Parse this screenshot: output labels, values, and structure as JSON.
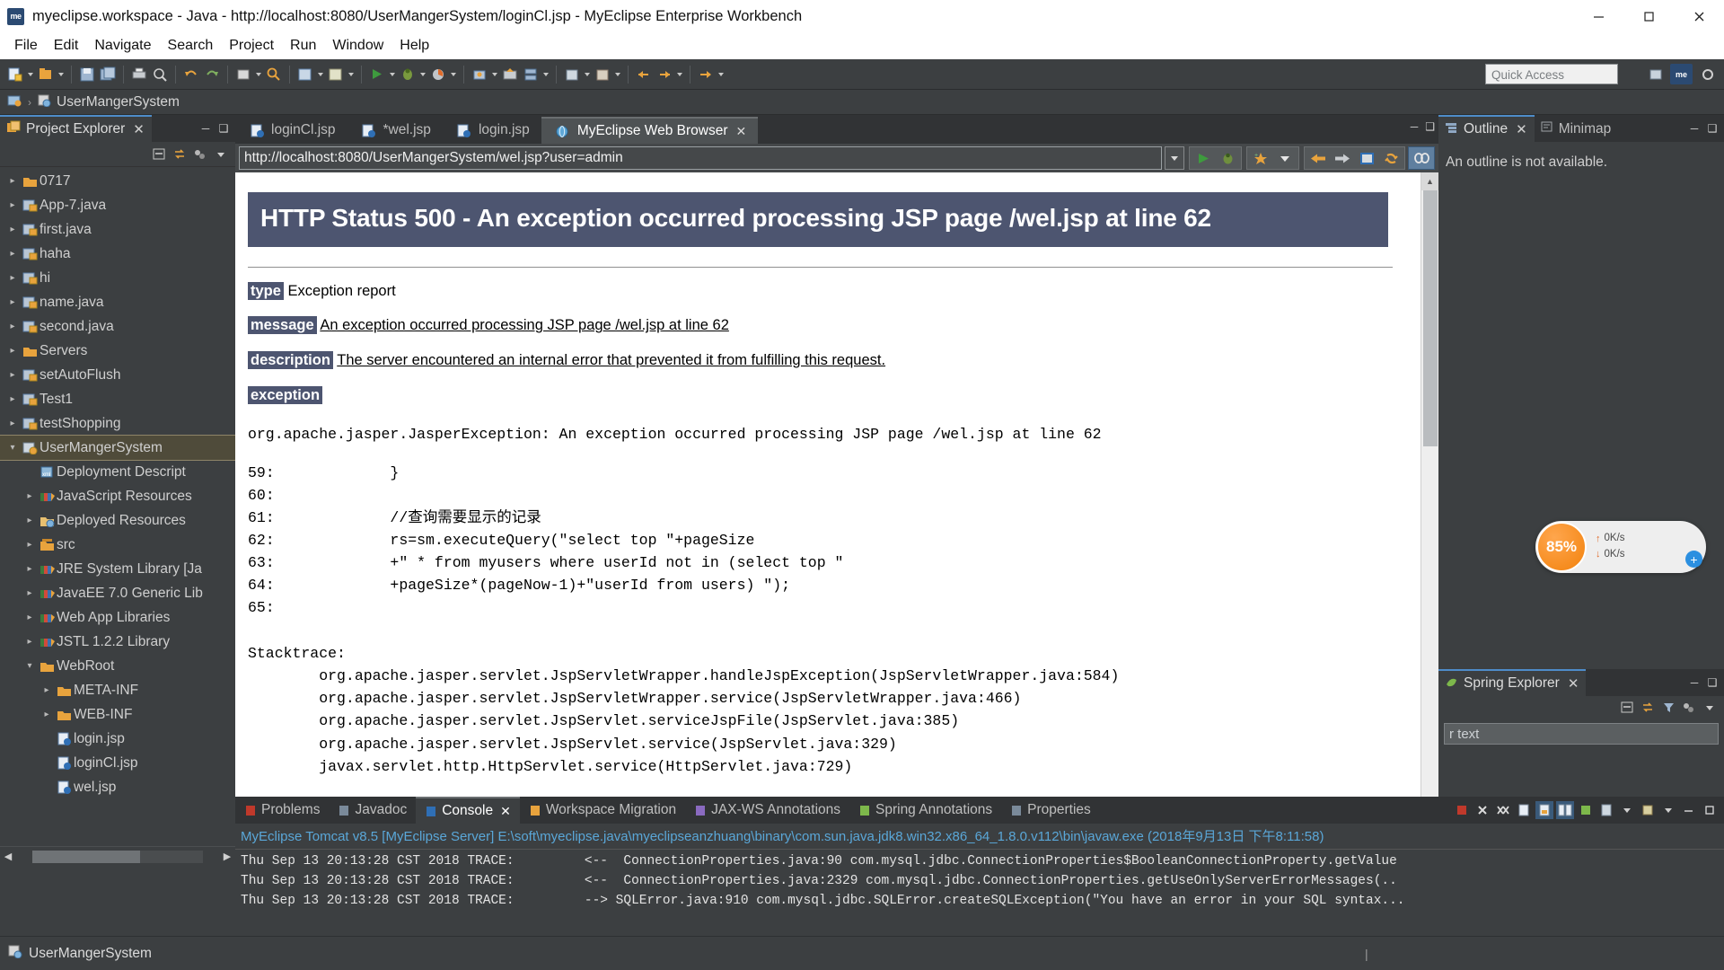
{
  "window": {
    "title": "myeclipse.workspace - Java - http://localhost:8080/UserMangerSystem/loginCl.jsp - MyEclipse Enterprise Workbench",
    "logo_text": "me",
    "minimize_label": "─",
    "maximize_label": "❐",
    "close_label": "✕"
  },
  "menubar": {
    "items": [
      {
        "label": "File"
      },
      {
        "label": "Edit"
      },
      {
        "label": "Navigate"
      },
      {
        "label": "Search"
      },
      {
        "label": "Project"
      },
      {
        "label": "Run"
      },
      {
        "label": "Window"
      },
      {
        "label": "Help"
      }
    ]
  },
  "toolbar": {
    "quick_access_placeholder": "Quick Access",
    "perspective_buttons": [
      "⌘",
      "me",
      "⚙"
    ]
  },
  "breadcrumb": {
    "root_icon": "java-perspective-icon",
    "separator": "›",
    "project": "UserMangerSystem"
  },
  "project_explorer": {
    "tab_label": "Project Explorer",
    "tab_close": "✕",
    "minimize": "─",
    "maximize": "❑",
    "toolbar_icons": [
      "collapse-all-icon",
      "link-with-editor-icon",
      "view-menu-icon",
      "view-dropdown-icon"
    ],
    "items": [
      {
        "label": "0717",
        "icon": "folder-icon",
        "arrow": "closed",
        "indent": 0,
        "selected": false
      },
      {
        "label": "App-7.java",
        "icon": "java-project-icon",
        "arrow": "closed",
        "indent": 0,
        "selected": false
      },
      {
        "label": "first.java",
        "icon": "java-project-icon",
        "arrow": "closed",
        "indent": 0,
        "selected": false
      },
      {
        "label": "haha",
        "icon": "java-project-icon",
        "arrow": "closed",
        "indent": 0,
        "selected": false
      },
      {
        "label": "hi",
        "icon": "java-project-icon",
        "arrow": "closed",
        "indent": 0,
        "selected": false
      },
      {
        "label": "name.java",
        "icon": "java-project-icon",
        "arrow": "closed",
        "indent": 0,
        "selected": false
      },
      {
        "label": "second.java",
        "icon": "java-project-icon",
        "arrow": "closed",
        "indent": 0,
        "selected": false
      },
      {
        "label": "Servers",
        "icon": "folder-icon",
        "arrow": "closed",
        "indent": 0,
        "selected": false
      },
      {
        "label": "setAutoFlush",
        "icon": "java-project-icon",
        "arrow": "closed",
        "indent": 0,
        "selected": false
      },
      {
        "label": "Test1",
        "icon": "java-project-icon",
        "arrow": "closed",
        "indent": 0,
        "selected": false
      },
      {
        "label": "testShopping",
        "icon": "java-project-icon",
        "arrow": "closed",
        "indent": 0,
        "selected": false
      },
      {
        "label": "UserMangerSystem",
        "icon": "web-project-icon",
        "arrow": "open",
        "indent": 0,
        "selected": true
      },
      {
        "label": "Deployment Descript",
        "icon": "deployment-descriptor-icon",
        "arrow": "none",
        "indent": 1,
        "selected": false
      },
      {
        "label": "JavaScript Resources",
        "icon": "library-icon",
        "arrow": "closed",
        "indent": 1,
        "selected": false
      },
      {
        "label": "Deployed Resources",
        "icon": "deployed-resources-icon",
        "arrow": "closed",
        "indent": 1,
        "selected": false
      },
      {
        "label": "src",
        "icon": "source-folder-icon",
        "arrow": "closed",
        "indent": 1,
        "selected": false
      },
      {
        "label": "JRE System Library  [Ja",
        "icon": "library-icon",
        "arrow": "closed",
        "indent": 1,
        "selected": false
      },
      {
        "label": "JavaEE 7.0 Generic Lib",
        "icon": "library-icon",
        "arrow": "closed",
        "indent": 1,
        "selected": false
      },
      {
        "label": "Web App Libraries",
        "icon": "library-icon",
        "arrow": "closed",
        "indent": 1,
        "selected": false
      },
      {
        "label": "JSTL 1.2.2 Library",
        "icon": "library-icon",
        "arrow": "closed",
        "indent": 1,
        "selected": false
      },
      {
        "label": "WebRoot",
        "icon": "folder-icon",
        "arrow": "open",
        "indent": 1,
        "selected": false
      },
      {
        "label": "META-INF",
        "icon": "folder-icon",
        "arrow": "closed",
        "indent": 2,
        "selected": false
      },
      {
        "label": "WEB-INF",
        "icon": "folder-icon",
        "arrow": "closed",
        "indent": 2,
        "selected": false
      },
      {
        "label": "login.jsp",
        "icon": "jsp-file-icon",
        "arrow": "none",
        "indent": 2,
        "selected": false
      },
      {
        "label": "loginCl.jsp",
        "icon": "jsp-file-icon",
        "arrow": "none",
        "indent": 2,
        "selected": false
      },
      {
        "label": "wel.jsp",
        "icon": "jsp-file-icon",
        "arrow": "none",
        "indent": 2,
        "selected": false
      }
    ]
  },
  "editor": {
    "tabs": [
      {
        "label": "loginCl.jsp",
        "icon": "jsp-file-icon",
        "active": false,
        "closable": false
      },
      {
        "label": "*wel.jsp",
        "icon": "jsp-file-icon",
        "active": false,
        "closable": false
      },
      {
        "label": "login.jsp",
        "icon": "jsp-file-icon",
        "active": false,
        "closable": false
      },
      {
        "label": "MyEclipse Web Browser",
        "icon": "globe-icon",
        "active": true,
        "closable": true
      }
    ],
    "tab_close": "✕",
    "minimize": "─",
    "maximize": "❑"
  },
  "browser": {
    "url": "http://localhost:8080/UserMangerSystem/wel.jsp?user=admin",
    "url_dropdown_icon": "chevron-down-icon",
    "buttons": [
      {
        "name": "run-icon",
        "glyph": "▶"
      },
      {
        "name": "debug-icon",
        "glyph": "⚙"
      },
      {
        "name": "new-wizard-icon",
        "glyph": "✦"
      },
      {
        "name": "dropdown-icon",
        "glyph": "▼"
      },
      {
        "name": "back-icon",
        "glyph": "←"
      },
      {
        "name": "forward-icon",
        "glyph": "→"
      },
      {
        "name": "stop-icon",
        "glyph": "■"
      },
      {
        "name": "refresh-icon",
        "glyph": "↻"
      },
      {
        "name": "link-icon",
        "glyph": "⚭"
      }
    ]
  },
  "page": {
    "heading": "HTTP Status 500 - An exception occurred processing JSP page /wel.jsp at line 62",
    "rows": [
      {
        "key": "type",
        "value": "Exception report",
        "underline": false
      },
      {
        "key": "message",
        "value": "An exception occurred processing JSP page /wel.jsp at line 62",
        "underline": true
      },
      {
        "key": "description",
        "value": "The server encountered an internal error that prevented it from fulfilling this request.",
        "underline": true
      },
      {
        "key": "exception",
        "value": "",
        "underline": false
      }
    ],
    "exception_line": "org.apache.jasper.JasperException: An exception occurred processing JSP page /wel.jsp at line 62",
    "code_snippet": "59:             }\n60: \n61:             //查询需要显示的记录\n62:             rs=sm.executeQuery(\"select top \"+pageSize\n63:             +\" * from myusers where userId not in (select top \"\n64:             +pageSize*(pageNow-1)+\"userId from users) \");\n65: ",
    "stacktrace_label": "Stacktrace:",
    "stacktrace": "        org.apache.jasper.servlet.JspServletWrapper.handleJspException(JspServletWrapper.java:584)\n        org.apache.jasper.servlet.JspServletWrapper.service(JspServletWrapper.java:466)\n        org.apache.jasper.servlet.JspServlet.serviceJspFile(JspServlet.java:385)\n        org.apache.jasper.servlet.JspServlet.service(JspServlet.java:329)\n        javax.servlet.http.HttpServlet.service(HttpServlet.java:729)",
    "header_bg": "#4d5570"
  },
  "outline": {
    "tab_label": "Outline",
    "tab_close": "✕",
    "minimap_tab_label": "Minimap",
    "empty_message": "An outline is not available.",
    "minimize": "─",
    "maximize": "❑"
  },
  "spring_explorer": {
    "tab_label": "Spring Explorer",
    "tab_close": "✕",
    "filter_text": "r text",
    "minimize": "─",
    "maximize": "❑"
  },
  "network_widget": {
    "percent": "85%",
    "upload_rate": "0K/s",
    "download_rate": "0K/s",
    "upload_arrow": "↑",
    "download_arrow": "↓",
    "plus_label": "+",
    "accent_color": "#f2820d"
  },
  "console": {
    "tabs": [
      {
        "label": "Problems",
        "icon": "problems-icon",
        "active": false,
        "closable": false
      },
      {
        "label": "Javadoc",
        "icon": "javadoc-icon",
        "active": false,
        "closable": false
      },
      {
        "label": "Console",
        "icon": "console-icon",
        "active": true,
        "closable": true
      },
      {
        "label": "Workspace Migration",
        "icon": "migration-icon",
        "active": false,
        "closable": false
      },
      {
        "label": "JAX-WS Annotations",
        "icon": "jaxws-icon",
        "active": false,
        "closable": false
      },
      {
        "label": "Spring Annotations",
        "icon": "spring-icon",
        "active": false,
        "closable": false
      },
      {
        "label": "Properties",
        "icon": "properties-icon",
        "active": false,
        "closable": false
      }
    ],
    "tab_close": "✕",
    "header": "MyEclipse Tomcat v8.5 [MyEclipse Server] E:\\soft\\myeclipse.java\\myeclipseanzhuang\\binary\\com.sun.java.jdk8.win32.x86_64_1.8.0.v112\\bin\\javaw.exe (2018年9月13日 下午8:11:58)",
    "lines": [
      "Thu Sep 13 20:13:28 CST 2018 TRACE:         <--  ConnectionProperties.java:90 com.mysql.jdbc.ConnectionProperties$BooleanConnectionProperty.getValue",
      "Thu Sep 13 20:13:28 CST 2018 TRACE:         <--  ConnectionProperties.java:2329 com.mysql.jdbc.ConnectionProperties.getUseOnlyServerErrorMessages(..",
      "Thu Sep 13 20:13:28 CST 2018 TRACE:         --> SQLError.java:910 com.mysql.jdbc.SQLError.createSQLException(\"You have an error in your SQL syntax..."
    ],
    "toolbar_icons": [
      "terminate-icon",
      "remove-launch-icon",
      "remove-all-icon",
      "clear-console-icon",
      "scroll-lock-icon",
      "pin-console-icon",
      "display-selected-icon",
      "open-console-icon",
      "console-menu-icon"
    ]
  },
  "statusbar": {
    "icon": "web-project-icon",
    "text": "UserMangerSystem"
  }
}
